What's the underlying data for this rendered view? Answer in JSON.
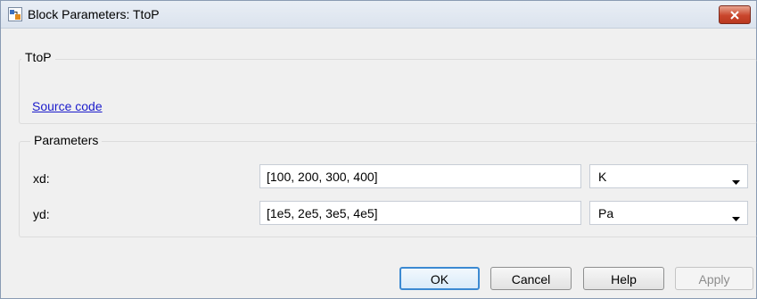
{
  "window": {
    "title": "Block Parameters: TtoP",
    "close_icon": "close-icon"
  },
  "description_group": {
    "title": "TtoP",
    "source_link": "Source code"
  },
  "parameters_group": {
    "title": "Parameters",
    "rows": [
      {
        "label": "xd:",
        "value": "[100, 200, 300, 400]",
        "unit": "K"
      },
      {
        "label": "yd:",
        "value": "[1e5, 2e5, 3e5, 4e5]",
        "unit": "Pa"
      }
    ]
  },
  "buttons": {
    "ok": "OK",
    "cancel": "Cancel",
    "help": "Help",
    "apply": "Apply"
  },
  "colors": {
    "link": "#1c1ccb",
    "close_button": "#c9462c",
    "default_button_border": "#3c8ad2"
  }
}
